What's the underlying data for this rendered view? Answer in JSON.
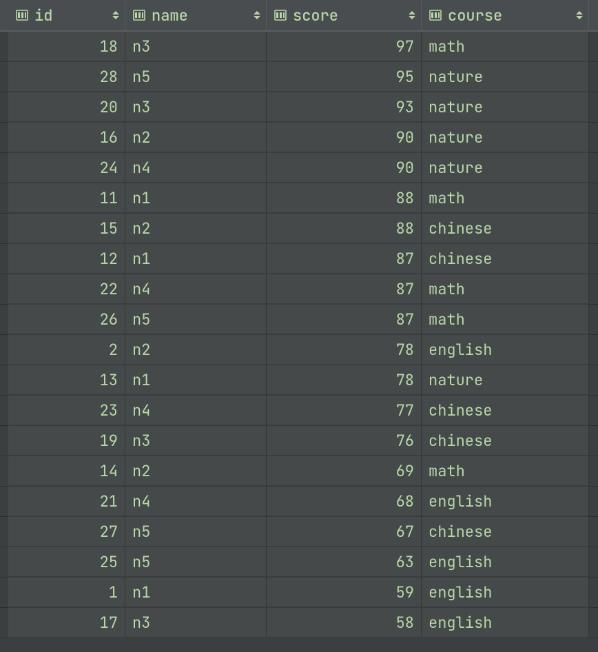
{
  "columns": [
    {
      "key": "id",
      "label": "id",
      "align": "num"
    },
    {
      "key": "name",
      "label": "name",
      "align": "txt"
    },
    {
      "key": "score",
      "label": "score",
      "align": "num"
    },
    {
      "key": "course",
      "label": "course",
      "align": "txt"
    }
  ],
  "rows": [
    {
      "id": "18",
      "name": "n3",
      "score": "97",
      "course": "math"
    },
    {
      "id": "28",
      "name": "n5",
      "score": "95",
      "course": "nature"
    },
    {
      "id": "20",
      "name": "n3",
      "score": "93",
      "course": "nature"
    },
    {
      "id": "16",
      "name": "n2",
      "score": "90",
      "course": "nature"
    },
    {
      "id": "24",
      "name": "n4",
      "score": "90",
      "course": "nature"
    },
    {
      "id": "11",
      "name": "n1",
      "score": "88",
      "course": "math"
    },
    {
      "id": "15",
      "name": "n2",
      "score": "88",
      "course": "chinese"
    },
    {
      "id": "12",
      "name": "n1",
      "score": "87",
      "course": "chinese"
    },
    {
      "id": "22",
      "name": "n4",
      "score": "87",
      "course": "math"
    },
    {
      "id": "26",
      "name": "n5",
      "score": "87",
      "course": "math"
    },
    {
      "id": "2",
      "name": "n2",
      "score": "78",
      "course": "english"
    },
    {
      "id": "13",
      "name": "n1",
      "score": "78",
      "course": "nature"
    },
    {
      "id": "23",
      "name": "n4",
      "score": "77",
      "course": "chinese"
    },
    {
      "id": "19",
      "name": "n3",
      "score": "76",
      "course": "chinese"
    },
    {
      "id": "14",
      "name": "n2",
      "score": "69",
      "course": "math"
    },
    {
      "id": "21",
      "name": "n4",
      "score": "68",
      "course": "english"
    },
    {
      "id": "27",
      "name": "n5",
      "score": "67",
      "course": "chinese"
    },
    {
      "id": "25",
      "name": "n5",
      "score": "63",
      "course": "english"
    },
    {
      "id": "1",
      "name": "n1",
      "score": "59",
      "course": "english"
    },
    {
      "id": "17",
      "name": "n3",
      "score": "58",
      "course": "english"
    }
  ]
}
